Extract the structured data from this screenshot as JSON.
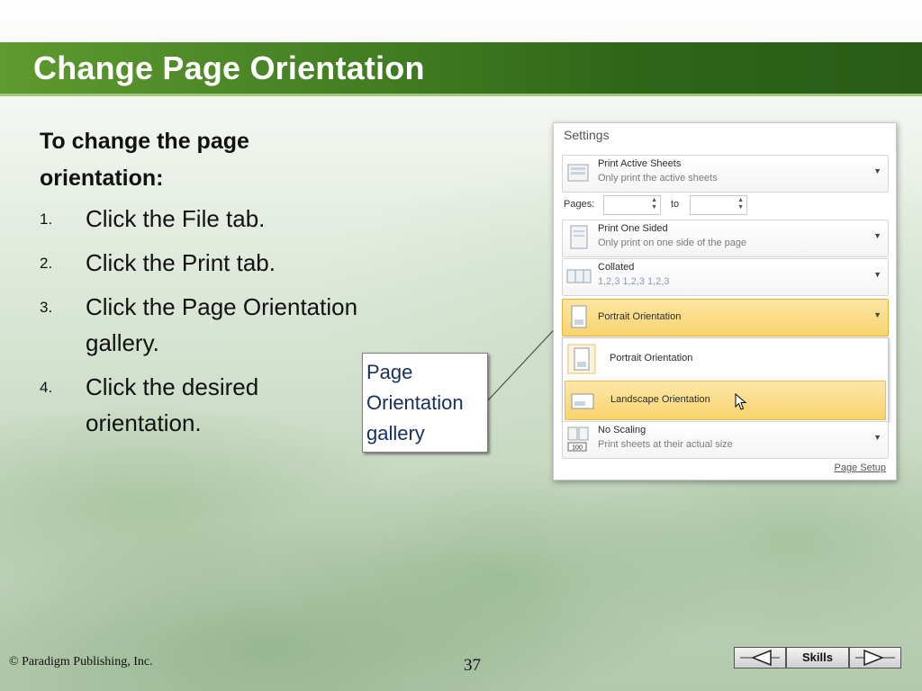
{
  "slide": {
    "title": "Change Page Orientation",
    "lead": "To change the page orientation:",
    "steps": [
      {
        "num": "1.",
        "text": "Click the File tab."
      },
      {
        "num": "2.",
        "text": "Click the Print tab."
      },
      {
        "num": "3.",
        "text": "Click the Page Orientation gallery."
      },
      {
        "num": "4.",
        "text": "Click the desired orientation."
      }
    ],
    "callout": "Page Orientation gallery"
  },
  "panel": {
    "title": "Settings",
    "print_active": {
      "main": "Print Active Sheets",
      "sub": "Only print the active sheets"
    },
    "pages_label": "Pages:",
    "to_label": "to",
    "print_sided": {
      "main": "Print One Sided",
      "sub": "Only print on one side of the page"
    },
    "collated": {
      "main": "Collated",
      "sub": "1,2,3   1,2,3   1,2,3"
    },
    "orientation": {
      "main": "Portrait Orientation"
    },
    "options": [
      {
        "label": "Portrait Orientation"
      },
      {
        "label": "Landscape Orientation"
      }
    ],
    "scaling": {
      "main": "No Scaling",
      "sub": "Print sheets at their actual size",
      "icon_text": "100"
    },
    "page_setup": "Page Setup"
  },
  "footer": {
    "copyright": "© Paradigm Publishing, Inc.",
    "page_number": "37",
    "skills_label": "Skills"
  },
  "colors": {
    "title_bar": "#3f7a21",
    "highlight": "#f9d46f",
    "callout_text": "#16305e"
  }
}
